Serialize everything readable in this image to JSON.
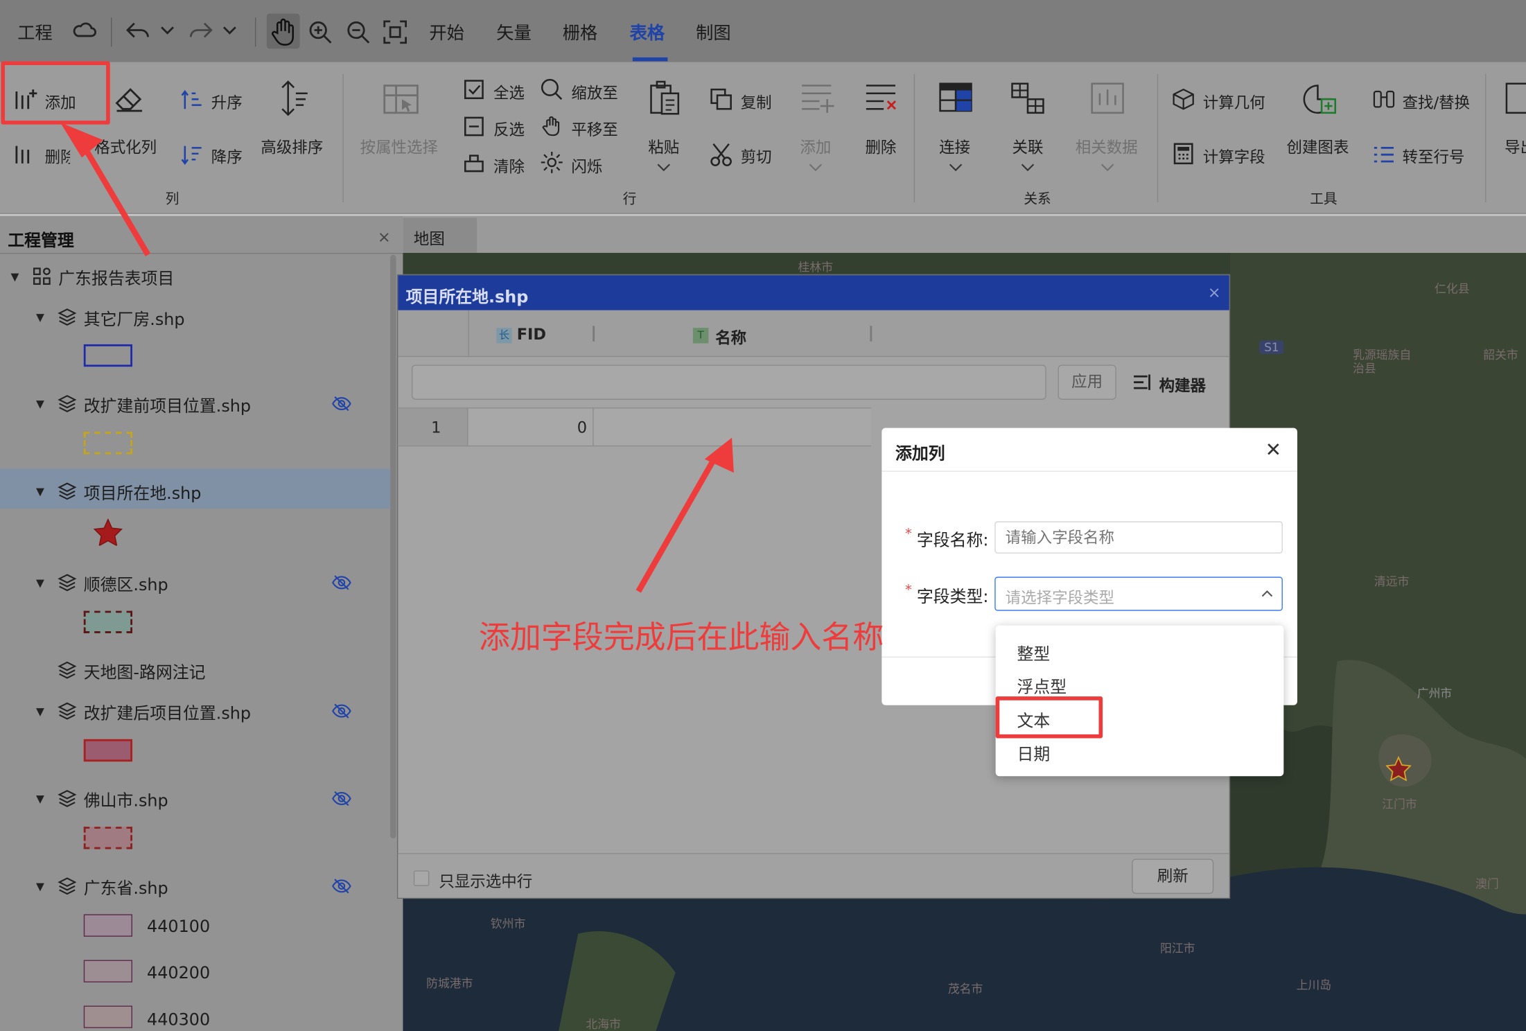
{
  "topbar": {
    "tabs": [
      "工程",
      "开始",
      "矢量",
      "栅格",
      "表格",
      "制图"
    ],
    "active_tab": "表格"
  },
  "ribbon": {
    "column": {
      "add": "添加",
      "delete": "删除",
      "format": "格式化列",
      "ascending": "升序",
      "descending": "降序",
      "advanced_sort": "高级排序",
      "group_label": "列"
    },
    "row": {
      "select_by_attr": "按属性选择",
      "select_all": "全选",
      "invert": "反选",
      "clear": "清除",
      "zoom_to": "缩放至",
      "pan_to": "平移至",
      "flash": "闪烁",
      "paste": "粘贴",
      "copy": "复制",
      "cut": "剪切",
      "add": "添加",
      "delete": "删除",
      "group_label": "行"
    },
    "relation": {
      "join": "连接",
      "relate": "关联",
      "related_data": "相关数据",
      "group_label": "关系"
    },
    "tools": {
      "calc_geometry": "计算几何",
      "calc_field": "计算字段",
      "create_chart": "创建图表",
      "find_replace": "查找/替换",
      "goto_row": "转至行号",
      "export": "导出",
      "group_label": "工具"
    }
  },
  "project_panel": {
    "title": "工程管理",
    "close": "×",
    "root": "广东报告表项目",
    "layers": [
      {
        "name": "其它厂房.shp"
      },
      {
        "name": "改扩建前项目位置.shp"
      },
      {
        "name": "项目所在地.shp"
      },
      {
        "name": "顺德区.shp"
      },
      {
        "name": "天地图-路网注记"
      },
      {
        "name": "改扩建后项目位置.shp"
      },
      {
        "name": "佛山市.shp"
      },
      {
        "name": "广东省.shp"
      }
    ],
    "legend_values": [
      "440100",
      "440200",
      "440300"
    ]
  },
  "map": {
    "tab": "地图",
    "labels": [
      "桂林市",
      "韶关市",
      "清远市",
      "广州市",
      "江门市",
      "澳门",
      "阳江市",
      "茂名市",
      "钦州市",
      "防城港市",
      "北海市",
      "上川岛",
      "仁化县",
      "乳源瑶族自治县",
      "S1"
    ]
  },
  "attribute_table": {
    "title": "项目所在地.shp",
    "close": "×",
    "columns": [
      {
        "type_icon": "长",
        "name": "FID"
      },
      {
        "type_icon": "T",
        "name": "名称"
      }
    ],
    "apply_button": "应用",
    "builder_button": "构建器",
    "rows": [
      {
        "row_no": "1",
        "fid": "0",
        "name": ""
      }
    ],
    "only_selected": "只显示选中行",
    "refresh": "刷新"
  },
  "add_column_dialog": {
    "title": "添加列",
    "close": "✕",
    "required_mark": "*",
    "field_name_label": "字段名称:",
    "field_name_placeholder": "请输入字段名称",
    "field_type_label": "字段类型:",
    "field_type_placeholder": "请选择字段类型",
    "options": [
      "整型",
      "浮点型",
      "文本",
      "日期"
    ]
  },
  "annotation": {
    "text": "添加字段完成后在此输入名称",
    "color": "#ee3b3b"
  },
  "colors": {
    "accent": "#2043a8",
    "title_bar": "#1c3b9a",
    "highlight": "#ee3b3b"
  }
}
